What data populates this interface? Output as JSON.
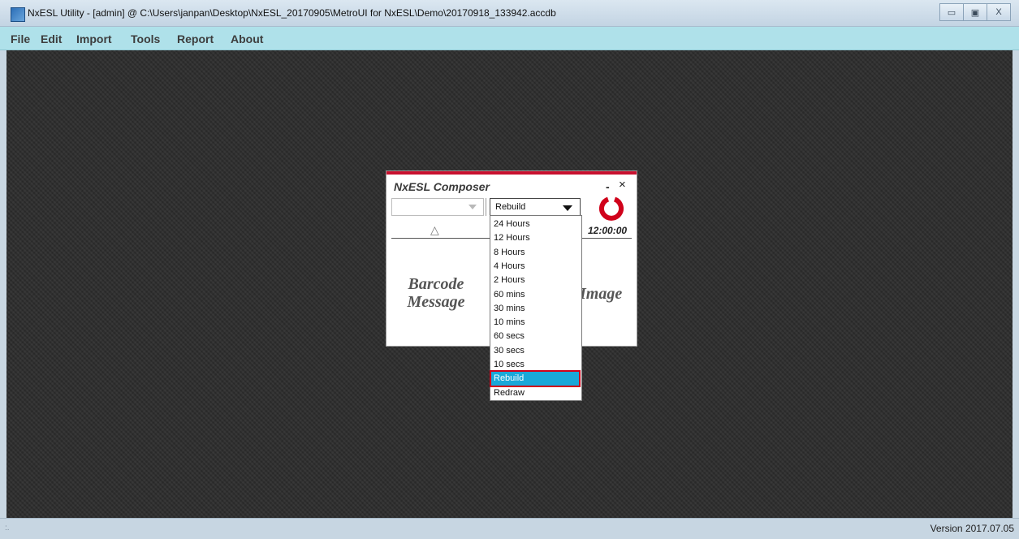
{
  "window": {
    "title": "NxESL Utility - [admin] @ C:\\Users\\janpan\\Desktop\\NxESL_20170905\\MetroUI for NxESL\\Demo\\20170918_133942.accdb",
    "controls": {
      "minimize": "▭",
      "maximize": "▣",
      "close": "X"
    }
  },
  "menu": [
    "File",
    "Edit",
    "Import",
    "Tools",
    "Report",
    "About"
  ],
  "composer": {
    "title": "NxESL Composer",
    "minimize": "-",
    "close": "×",
    "combo1_value": "",
    "interval_selected": "Rebuild",
    "time": "12:00:00",
    "sort_glyph": "△",
    "barcode_line1": "Barcode",
    "barcode_line2": "Message",
    "image_label": "Image",
    "accent_color": "#c8102e"
  },
  "dropdown": {
    "options": [
      "24 Hours",
      "12 Hours",
      "8 Hours",
      "4 Hours",
      "2 Hours",
      "60 mins",
      "30 mins",
      "10 mins",
      "60 secs",
      "30 secs",
      "10 secs",
      "Rebuild",
      "Redraw"
    ],
    "selected": "Rebuild",
    "highlight_color": "#19a8d9"
  },
  "status": {
    "version": "Version 2017.07.05",
    "grip": ":."
  }
}
